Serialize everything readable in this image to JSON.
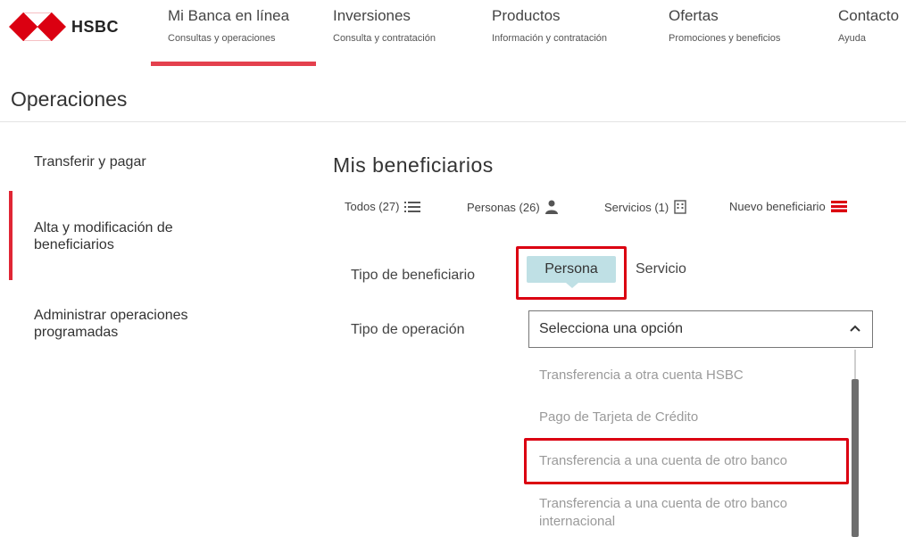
{
  "brand": {
    "name": "HSBC",
    "accent_color": "#db0011"
  },
  "nav": [
    {
      "title": "Mi Banca en línea",
      "subtitle": "Consultas y operaciones",
      "active": true
    },
    {
      "title": "Inversiones",
      "subtitle": "Consulta y contratación",
      "active": false
    },
    {
      "title": "Productos",
      "subtitle": "Información y contratación",
      "active": false
    },
    {
      "title": "Ofertas",
      "subtitle": "Promociones y beneficios",
      "active": false
    },
    {
      "title": "Contacto",
      "subtitle": "Ayuda",
      "active": false
    }
  ],
  "page_heading": "Operaciones",
  "sidebar": {
    "items": [
      {
        "label": "Transferir y pagar",
        "active": false
      },
      {
        "label": "Alta y modificación de beneficiarios",
        "active": true
      },
      {
        "label": "Administrar operaciones programadas",
        "active": false
      }
    ]
  },
  "main": {
    "title": "Mis beneficiarios",
    "filters": [
      {
        "label": "Todos (27)",
        "icon": "list-icon"
      },
      {
        "label": "Personas (26)",
        "icon": "person-icon"
      },
      {
        "label": "Servicios (1)",
        "icon": "building-icon"
      },
      {
        "label": "Nuevo beneficiario",
        "icon": "add-card-icon"
      }
    ],
    "beneficiary_type": {
      "label": "Tipo de beneficiario",
      "options": [
        "Persona",
        "Servicio"
      ],
      "selected": "Persona"
    },
    "operation_type": {
      "label": "Tipo de operación",
      "selected_text": "Selecciona una opción",
      "options": [
        "Transferencia a otra cuenta HSBC",
        "Pago de Tarjeta de Crédito",
        "Transferencia a una cuenta de otro banco",
        "Transferencia a una cuenta de otro banco internacional"
      ],
      "highlighted": "Transferencia a una cuenta de otro banco"
    }
  }
}
